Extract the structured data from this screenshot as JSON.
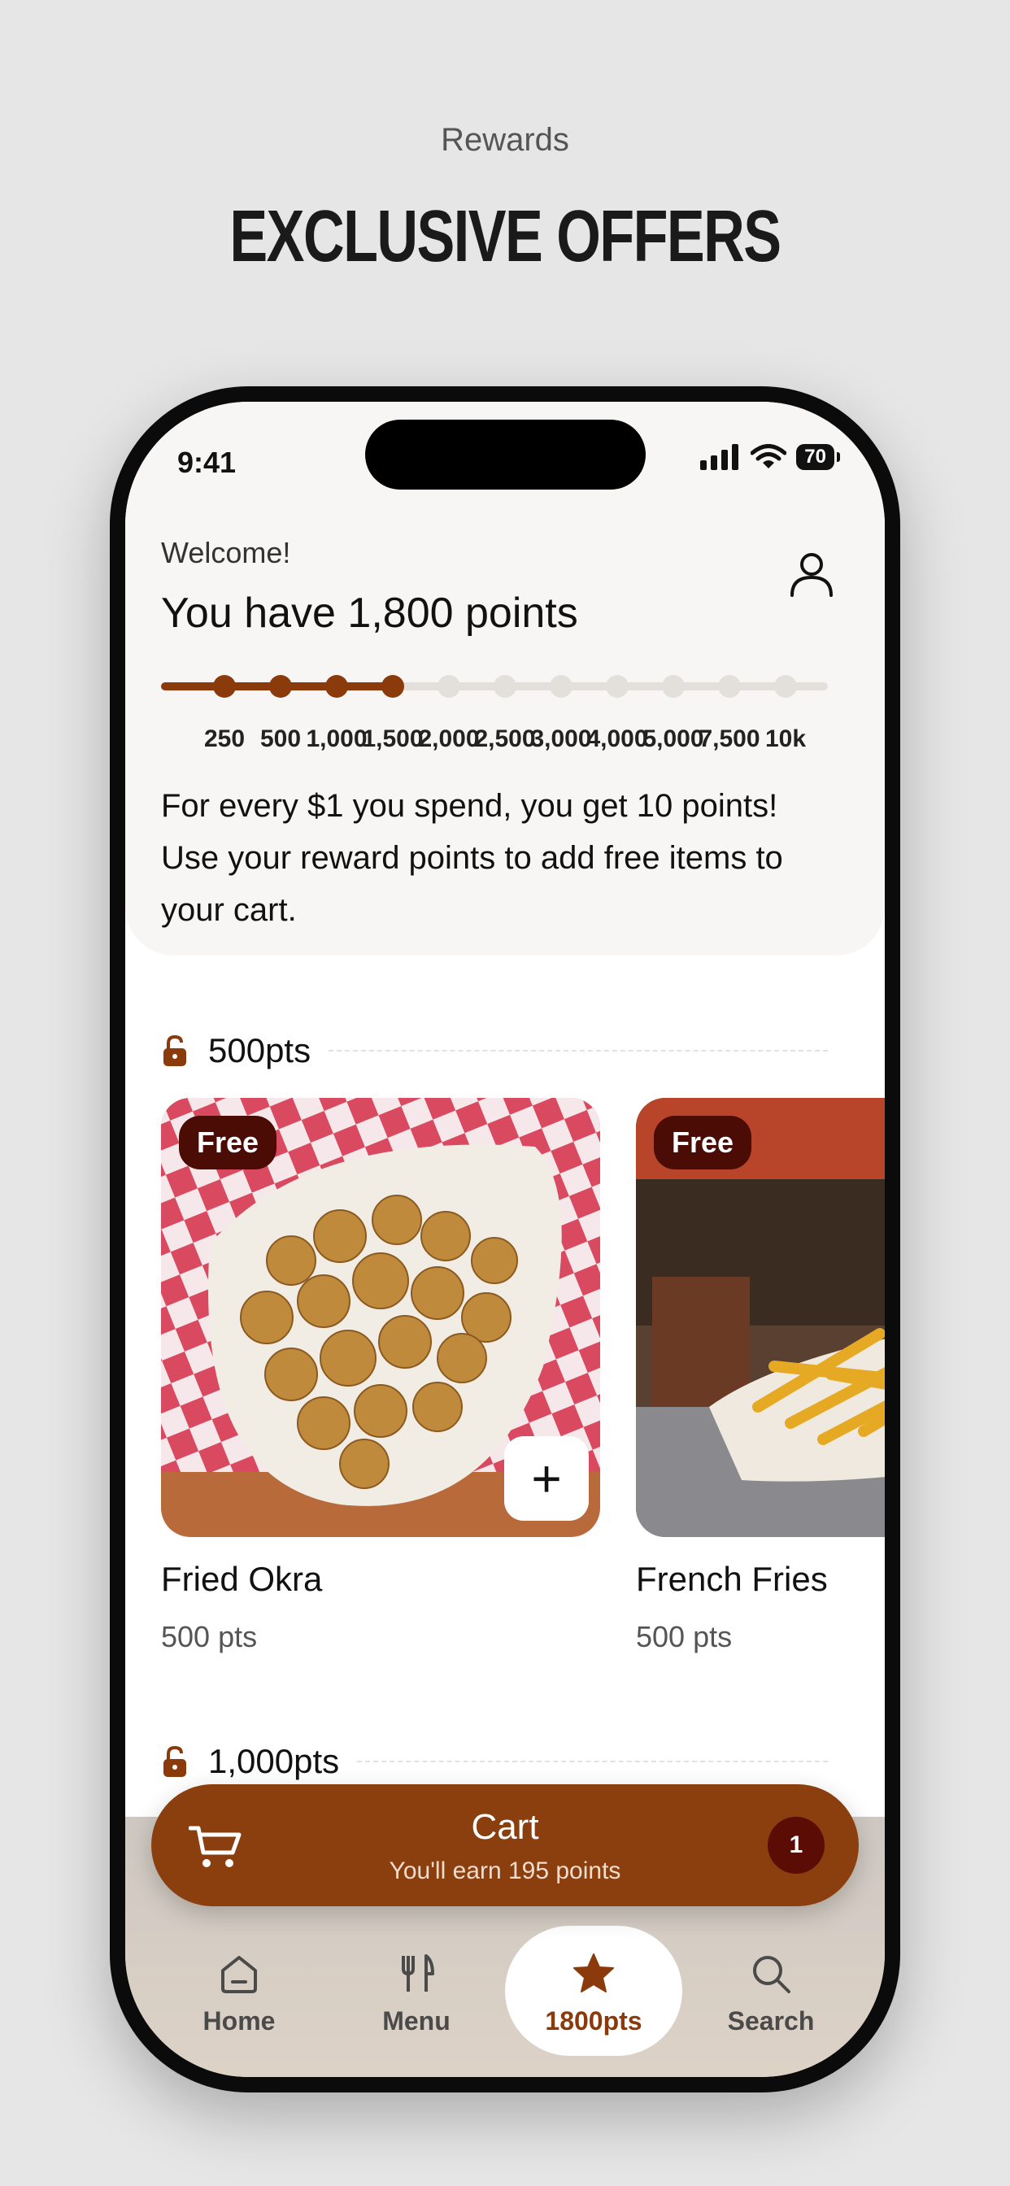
{
  "promo": {
    "eyebrow": "Rewards",
    "title": "EXCLUSIVE OFFERS"
  },
  "status_bar": {
    "time": "9:41",
    "battery": "70"
  },
  "header": {
    "welcome": "Welcome!",
    "points_headline": "You have 1,800 points",
    "profile_icon": "person-icon"
  },
  "tiers": {
    "labels": [
      "250",
      "500",
      "1,000",
      "1,500",
      "2,000",
      "2,500",
      "3,000",
      "4,000",
      "5,000",
      "7,500",
      "10k"
    ],
    "unlocked_count": 4,
    "progress_fraction": 0.34
  },
  "info_text": "For every $1 you spend, you get 10 points! Use your reward points to add free items to your cart.",
  "sections": [
    {
      "label": "500pts",
      "items": [
        {
          "name": "Fried Okra",
          "points": "500 pts",
          "badge": "Free",
          "add_label": "+"
        },
        {
          "name": "French Fries",
          "points": "500 pts",
          "badge": "Free"
        }
      ]
    },
    {
      "label": "1,000pts"
    }
  ],
  "cart": {
    "title": "Cart",
    "subtitle": "You'll earn 195 points",
    "count": "1"
  },
  "nav": [
    {
      "label": "Home",
      "icon": "home-icon"
    },
    {
      "label": "Menu",
      "icon": "fork-knife-icon"
    },
    {
      "label": "1800pts",
      "icon": "star-icon",
      "active": true
    },
    {
      "label": "Search",
      "icon": "search-icon"
    }
  ],
  "colors": {
    "accent": "#8b3b0b",
    "badge": "#4a0c04",
    "track": "#e3dfdb"
  }
}
